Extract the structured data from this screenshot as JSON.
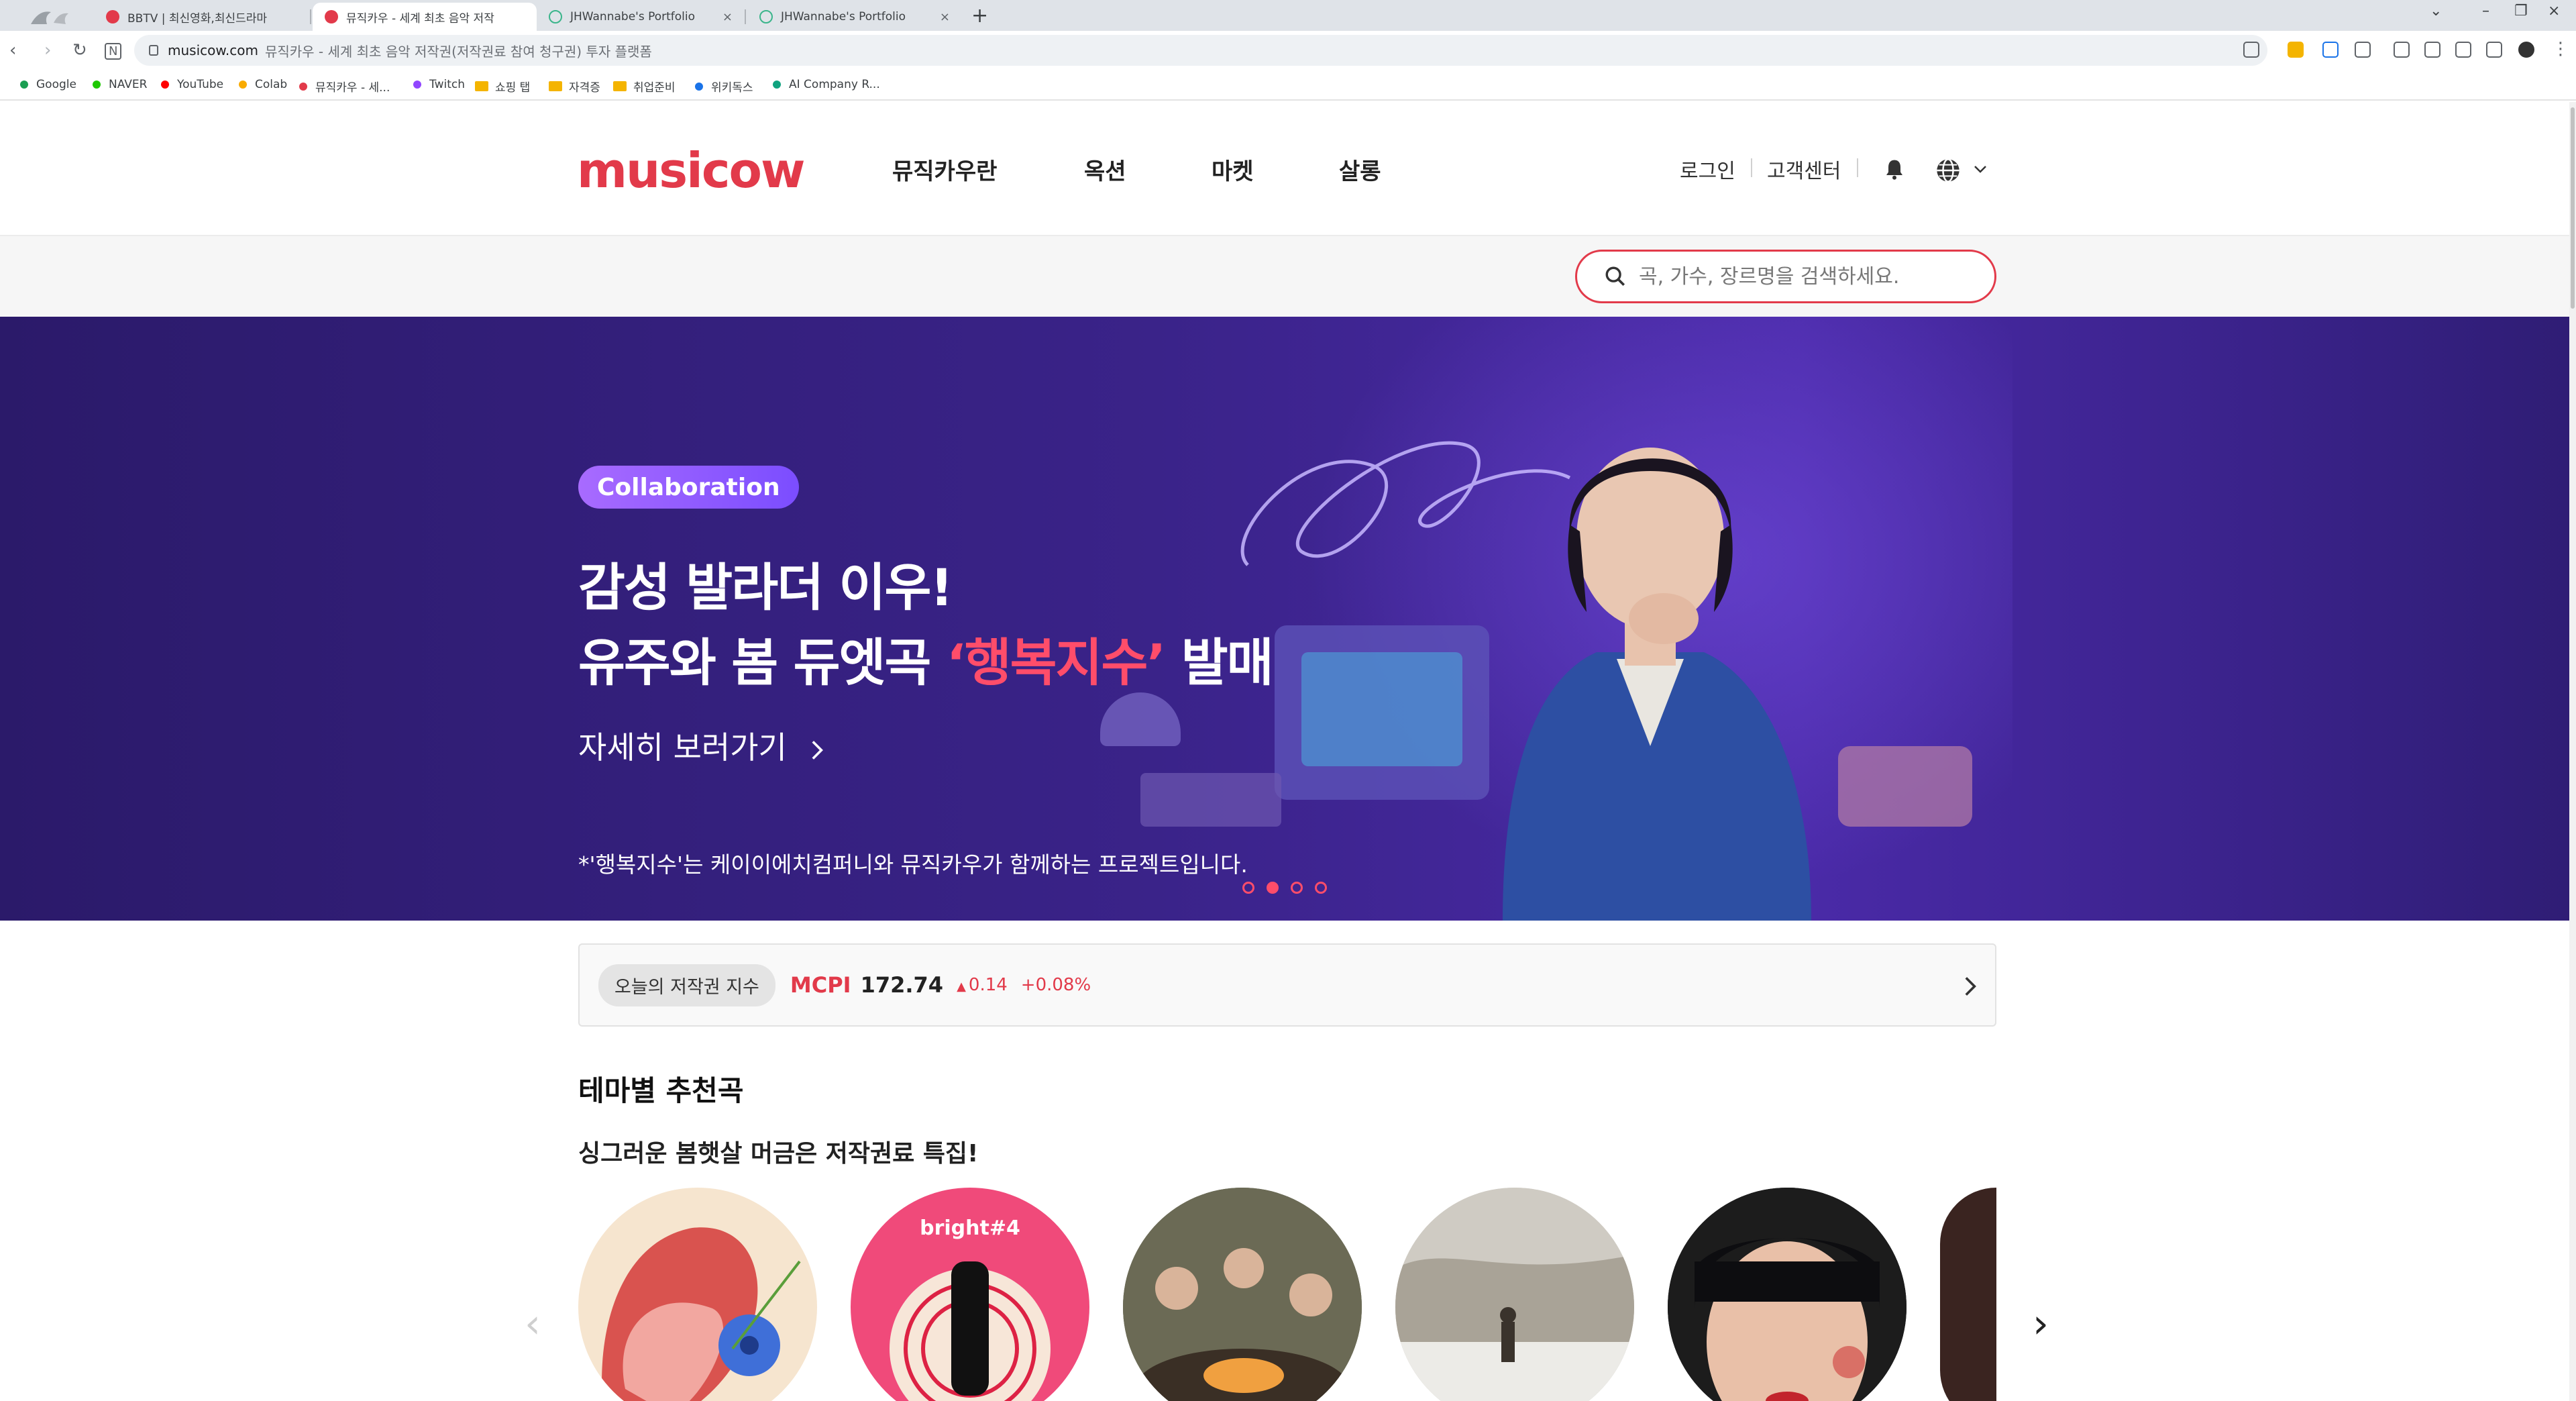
{
  "browser": {
    "tabs": [
      {
        "label": "BBTV | 최신영화,최신드라마",
        "active": false
      },
      {
        "label": "뮤직카우 - 세계 최초 음악 저작",
        "active": true
      },
      {
        "label": "JHWannabe's Portfolio",
        "active": false
      },
      {
        "label": "JHWannabe's Portfolio",
        "active": false
      }
    ],
    "new_tab": "+",
    "url_domain": "musicow.com",
    "url_title": "뮤직카우 - 세계 최초 음악 저작권(저작권료 참여 청구권) 투자 플랫폼",
    "bookmarks": [
      {
        "label": "Google",
        "color": "#1a9e52"
      },
      {
        "label": "NAVER",
        "color": "#1ec800"
      },
      {
        "label": "YouTube",
        "color": "#ff0000"
      },
      {
        "label": "Colab",
        "color": "#f9ab00"
      },
      {
        "label": "뮤직카우 - 세...",
        "color": "#e23a4a"
      },
      {
        "label": "Twitch",
        "color": "#9146ff"
      },
      {
        "label": "쇼핑 탭",
        "folder": true
      },
      {
        "label": "자격증",
        "folder": true
      },
      {
        "label": "취업준비",
        "folder": true
      },
      {
        "label": "위키독스",
        "color": "#1a73e8"
      },
      {
        "label": "AI Company R...",
        "color": "#10a37f"
      }
    ]
  },
  "header": {
    "logo": "musicow",
    "nav": [
      "뮤직카우란",
      "옥션",
      "마켓",
      "살롱"
    ],
    "login": "로그인",
    "support": "고객센터"
  },
  "search": {
    "placeholder": "곡, 가수, 장르명을 검색하세요."
  },
  "hero": {
    "badge": "Collaboration",
    "line1": "감성 발라더 이우!",
    "line2_pre": "유주와 봄 듀엣곡 ",
    "line2_hl": "‘행복지수’",
    "line2_post": " 발매",
    "cta": "자세히 보러가기",
    "note": "*'행복지수'는 케이이에치컴퍼니와 뮤직카우가 함께하는 프로젝트입니다.",
    "slide_count": 4,
    "active_slide": 2
  },
  "index": {
    "label": "오늘의 저작권 지수",
    "name": "MCPI",
    "value": "172.74",
    "change": "0.14",
    "percent": "+0.08%"
  },
  "theme": {
    "title": "테마별 추천곡",
    "subtitle": "싱그러운 봄햇살 머금은 저작권료 특집!"
  },
  "colors": {
    "brand": "#e23a4a",
    "hero_bg": "#3a2389",
    "highlight": "#ff4d6a"
  }
}
